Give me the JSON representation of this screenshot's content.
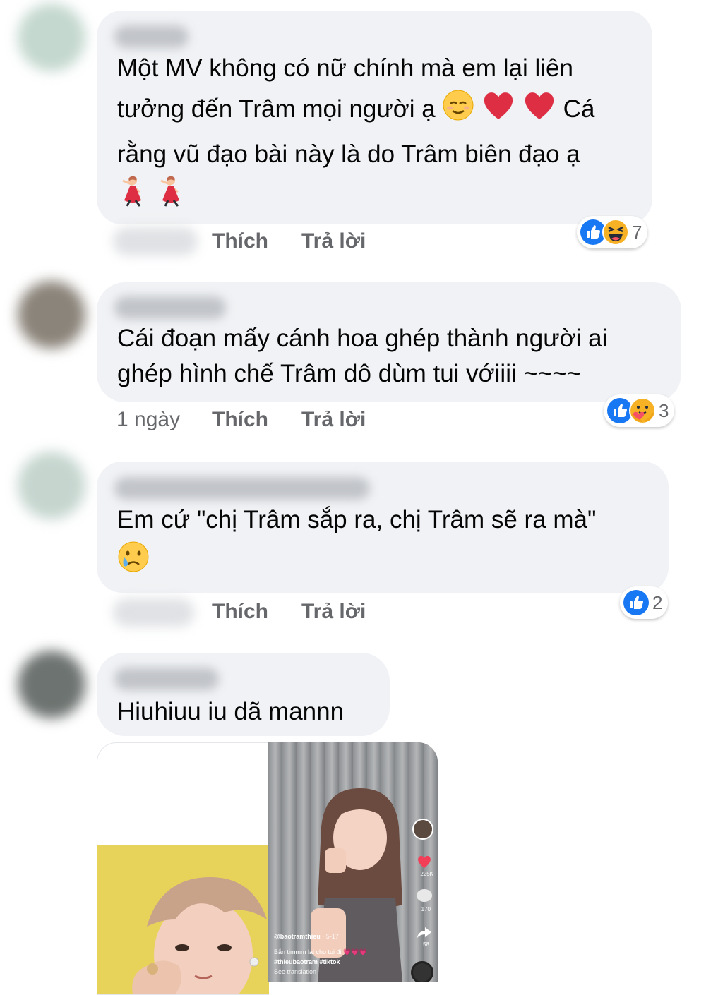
{
  "labels": {
    "like": "Thích",
    "reply": "Trả lời"
  },
  "comments": [
    {
      "lines": [
        "Một MV không có nữ chính mà em lại liên",
        "tưởng đến Trâm mọi người ạ",
        "Cá",
        "rằng vũ đạo bài này là do Trâm biên đạo ạ"
      ],
      "emojis": [
        "relieved-face",
        "red-heart",
        "red-heart",
        "woman-dancing",
        "woman-dancing"
      ],
      "time": "",
      "reactions": {
        "types": [
          "like",
          "laugh"
        ],
        "count": "7"
      }
    },
    {
      "lines": [
        "Cái đoạn mấy cánh hoa ghép thành người ai",
        "ghép hình chế Trâm dô dùm tui vớiiii ~~~~"
      ],
      "emojis": [],
      "time": "1 ngày",
      "reactions": {
        "types": [
          "like",
          "care"
        ],
        "count": "3"
      }
    },
    {
      "lines": [
        "Em cứ \"chị Trâm sắp ra, chị Trâm sẽ ra mà\""
      ],
      "emojis": [
        "crying-face"
      ],
      "time": "",
      "reactions": {
        "types": [
          "like"
        ],
        "count": "2"
      }
    },
    {
      "lines": [
        "Hiuhiuu iu dã mannn"
      ],
      "emojis": [],
      "time": "",
      "attachment": {
        "handle": "@baotramthieu",
        "date": "· 5-17",
        "caption": "Bắn timmm lại cho tui đi 💗💗💗",
        "tags": "#thieubaotram #tiktok",
        "see_translation": "See translation",
        "side_counts": [
          "225K",
          "170",
          "58"
        ]
      }
    }
  ],
  "colors": {
    "bubble": "#f0f2f5",
    "like_blue": "#1877f2",
    "meta_gray": "#65676b",
    "heart_red": "#f33e58",
    "yellow_bg": "#e8d35a"
  }
}
